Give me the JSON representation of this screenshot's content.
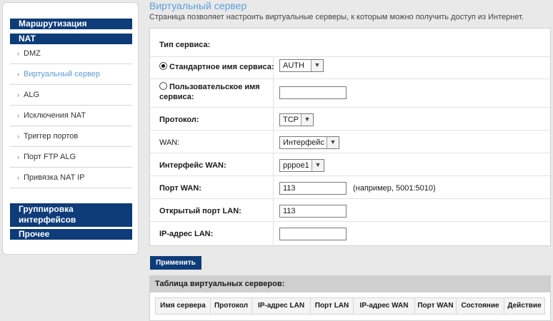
{
  "sidebar": {
    "routing": "Маршрутизация",
    "nat": "NAT",
    "nat_items": [
      "DMZ",
      "Виртуальный сервер",
      "ALG",
      "Исключения NAT",
      "Триггер портов",
      "Порт FTP ALG",
      "Привязка NAT IP"
    ],
    "active_item": "Виртуальный сервер",
    "grouping": "Группировка интерфейсов",
    "other": "Прочее"
  },
  "page": {
    "title": "Виртуальный сервер",
    "description": "Страница позволяет настроить виртуальные серверы, к которым можно получить доступ из Интернет."
  },
  "form": {
    "service_type_label": "Тип сервиса:",
    "standard_name_label": "Стандартное имя сервиса:",
    "standard_name_value": "AUTH",
    "custom_name_label": "Пользовательское имя сервиса:",
    "custom_name_value": "",
    "protocol_label": "Протокол:",
    "protocol_value": "TCP",
    "wan_label": "WAN:",
    "wan_value": "Интерфейс",
    "wan_interface_label": "Интерфейс WAN:",
    "wan_interface_value": "pppoe1",
    "wan_port_label": "Порт WAN:",
    "wan_port_value": "113",
    "wan_port_hint": "(например, 5001:5010)",
    "lan_port_label": "Открытый порт LAN:",
    "lan_port_value": "113",
    "lan_ip_label": "IP-адрес LAN:",
    "lan_ip_value": "",
    "selected_service_type": "standard"
  },
  "apply_label": "Применить",
  "table": {
    "title": "Таблица виртуальных серверов:",
    "columns": [
      "Имя сервера",
      "Протокол",
      "IP-адрес LAN",
      "Порт LAN",
      "IP-адрес WAN",
      "Порт WAN",
      "Состояние",
      "Действие"
    ]
  },
  "colors": {
    "nav_blue": "#0d3c78",
    "title_blue": "#5aa0dc",
    "active_link": "#5b9bd8"
  },
  "icons": {
    "dropdown": "chevron-down-icon",
    "list_bullet": "bullet-arrow-icon"
  }
}
